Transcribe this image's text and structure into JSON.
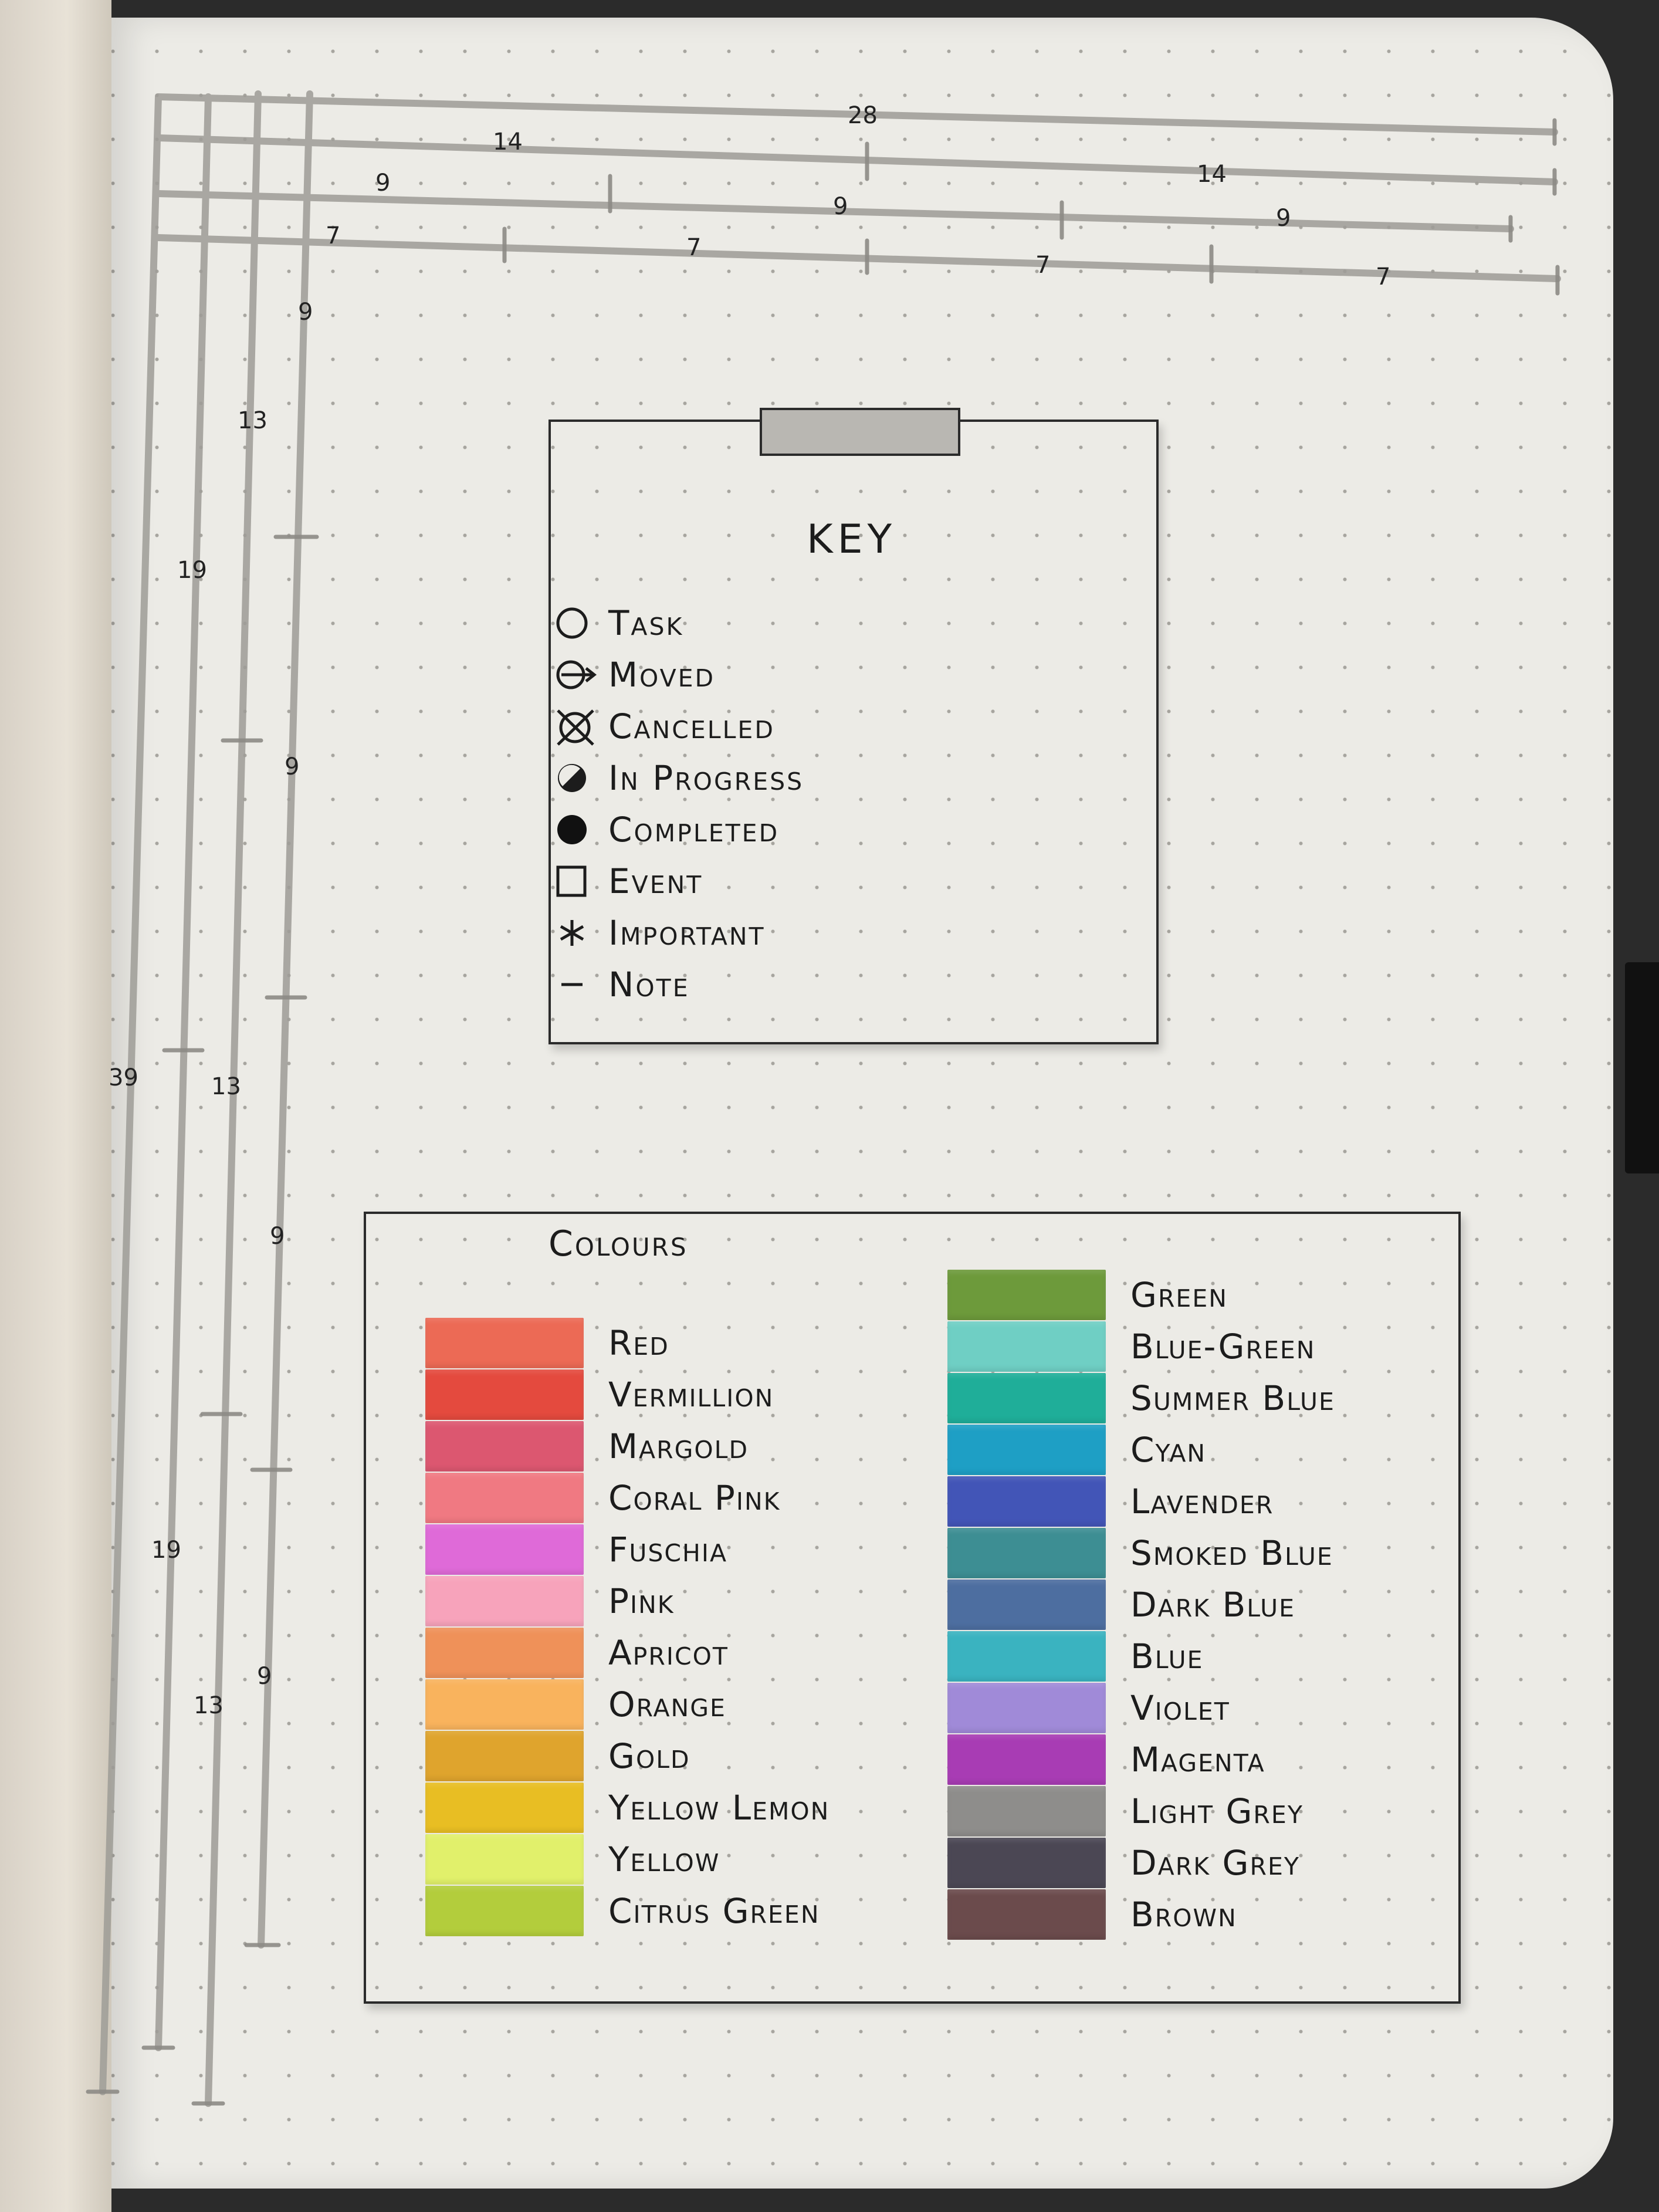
{
  "tracker": {
    "top_numbers": [
      "28",
      "14",
      "14",
      "9",
      "9",
      "9",
      "7",
      "7",
      "7",
      "7"
    ],
    "side_numbers": [
      "9",
      "13",
      "19",
      "9",
      "39",
      "13",
      "9",
      "19",
      "13",
      "9"
    ]
  },
  "key": {
    "title": "KEY",
    "items": [
      {
        "icon": "open-circle-icon",
        "label": "Task"
      },
      {
        "icon": "circle-arrow-icon",
        "label": "Moved"
      },
      {
        "icon": "crossed-circle-icon",
        "label": "Cancelled"
      },
      {
        "icon": "half-filled-circle-icon",
        "label": "In Progress"
      },
      {
        "icon": "filled-circle-icon",
        "label": "Completed"
      },
      {
        "icon": "square-icon",
        "label": "Event"
      },
      {
        "icon": "asterisk-icon",
        "label": "Important"
      },
      {
        "icon": "dash-icon",
        "label": "Note"
      }
    ]
  },
  "colours": {
    "title": "Colours",
    "left": [
      {
        "label": "Red",
        "color": "#ec6a55"
      },
      {
        "label": "Vermillion",
        "color": "#e44a3e"
      },
      {
        "label": "Margold",
        "color": "#dc5770"
      },
      {
        "label": "Coral Pink",
        "color": "#f07982"
      },
      {
        "label": "Fuschia",
        "color": "#df6ad8"
      },
      {
        "label": "Pink",
        "color": "#f7a3bb"
      },
      {
        "label": "Apricot",
        "color": "#ef9159"
      },
      {
        "label": "Orange",
        "color": "#f9b35d"
      },
      {
        "label": "Gold",
        "color": "#dfa42d"
      },
      {
        "label": "Yellow Lemon",
        "color": "#e8be23"
      },
      {
        "label": "Yellow",
        "color": "#e1f06b"
      },
      {
        "label": "Citrus Green",
        "color": "#b3cd3c"
      }
    ],
    "right": [
      {
        "label": "Green",
        "color": "#6d9a3b"
      },
      {
        "label": "Blue-Green",
        "color": "#6fcfc4"
      },
      {
        "label": "Summer Blue",
        "color": "#1fae99"
      },
      {
        "label": "Cyan",
        "color": "#1e9fc5"
      },
      {
        "label": "Lavender",
        "color": "#4255b7"
      },
      {
        "label": "Smoked Blue",
        "color": "#3d8e93"
      },
      {
        "label": "Dark Blue",
        "color": "#4d6ea0"
      },
      {
        "label": "Blue",
        "color": "#3ab3c0"
      },
      {
        "label": "Violet",
        "color": "#a08ad8"
      },
      {
        "label": "Magenta",
        "color": "#a83cb4"
      },
      {
        "label": "Light Grey",
        "color": "#8e8d8b"
      },
      {
        "label": "Dark Grey",
        "color": "#4b4754"
      },
      {
        "label": "Brown",
        "color": "#6b4b4c"
      }
    ]
  }
}
